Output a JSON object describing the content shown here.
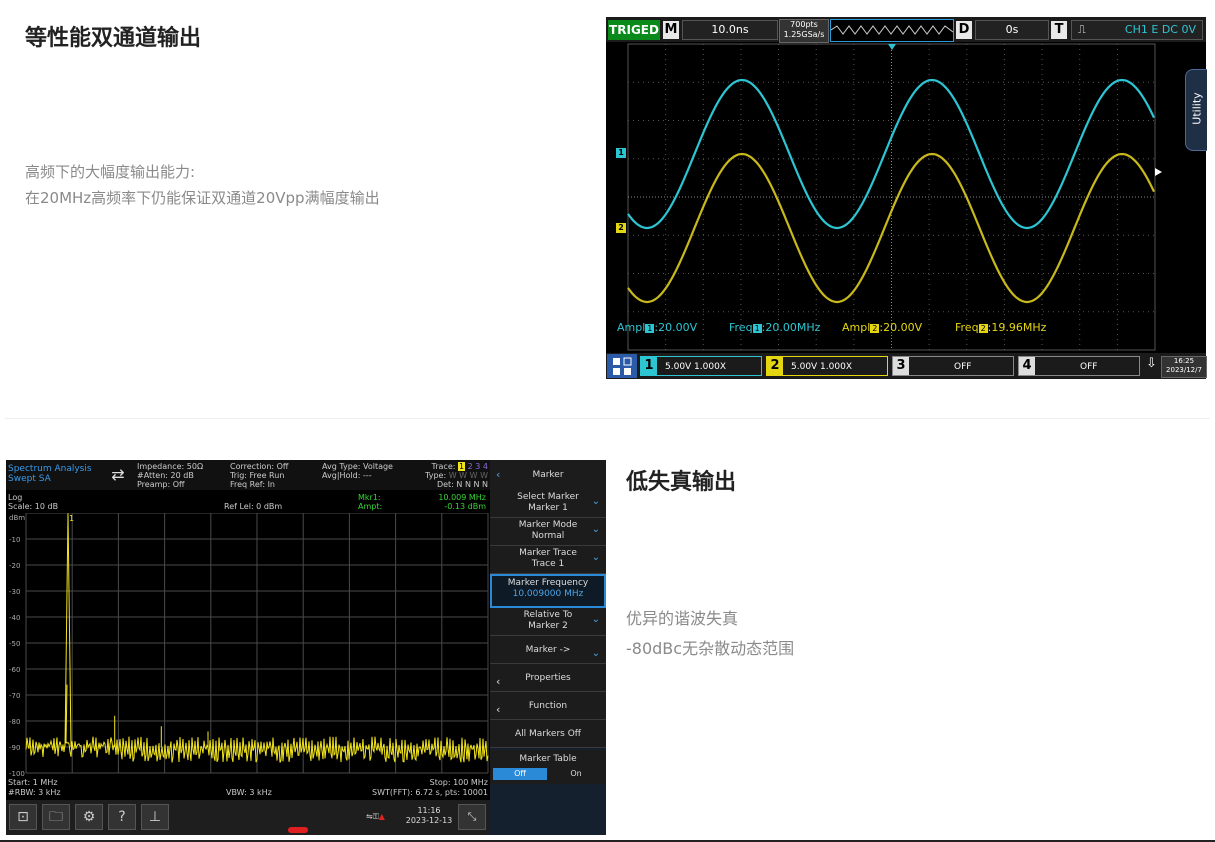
{
  "section1": {
    "title": "等性能双通道输出",
    "desc_line1": "高频下的大幅度输出能力:",
    "desc_line2": "在20MHz高频率下仍能保证双通道20Vpp满幅度输出"
  },
  "section2": {
    "title": "低失真输出",
    "desc_line1": "优异的谐波失真",
    "desc_line2": "-80dBc无杂散动态范围"
  },
  "scope": {
    "status": "TRIGED",
    "m_label": "M",
    "timebase": "10.0ns",
    "pts": "700pts",
    "sample_rate": "1.25GSa/s",
    "d_label": "D",
    "delay": "0s",
    "t_label": "T",
    "trigger_info": "CH1 E DC 0V",
    "utility": "Utility",
    "ch1_marker": "1",
    "ch2_marker": "2",
    "meas": {
      "ampl1_prefix": "Ampl",
      "ampl1_ch": "1",
      "ampl1_val": ":20.00V",
      "freq1_prefix": "Freq",
      "freq1_ch": "1",
      "freq1_val": ":20.00MHz",
      "ampl2_prefix": "Ampl",
      "ampl2_ch": "2",
      "ampl2_val": ":20.00V",
      "freq2_prefix": "Freq",
      "freq2_ch": "2",
      "freq2_val": ":19.96MHz"
    },
    "channels": [
      {
        "num": "1",
        "text": "5.00V 1.000X",
        "color": "#2ec5d3"
      },
      {
        "num": "2",
        "text": "5.00V 1.000X",
        "color": "#e5d612"
      },
      {
        "num": "3",
        "text": "OFF",
        "color": "#dddddd"
      },
      {
        "num": "4",
        "text": "OFF",
        "color": "#dddddd"
      }
    ],
    "time": "16:25",
    "date": "2023/12/7",
    "colors": {
      "ch1": "#2ec5d3",
      "ch2": "#c9b81c",
      "grid": "#555555"
    }
  },
  "spectrum": {
    "mode_line1": "Spectrum Analysis",
    "mode_line2": "Swept SA",
    "impedance": "Impedance: 50Ω",
    "atten": "#Atten: 20 dB",
    "preamp": "Preamp: Off",
    "correction": "Correction: Off",
    "trig": "Trig: Free Run",
    "freq_ref": "Freq Ref: In",
    "avg_type": "Avg Type: Voltage",
    "avg_hold": "Avg|Hold: ---",
    "trace_label": "Trace:",
    "type_label": "Type:",
    "det_label": "Det:",
    "trace_nums": [
      "1",
      "2",
      "3",
      "4"
    ],
    "type_vals": "W W W W",
    "det_vals": "N N N N",
    "log": "Log",
    "scale": "Scale: 10 dB",
    "ref_lvl": "Ref Lel: 0 dBm",
    "mkr_label": "Mkr1:",
    "mkr_freq": "10.009 MHz",
    "ampt_label": "Ampt:",
    "ampt_val": "-0.13 dBm",
    "unit": "dBm",
    "marker_num": "1",
    "yticks": [
      "-10",
      "-20",
      "-30",
      "-40",
      "-50",
      "-60",
      "-70",
      "-80",
      "-90",
      "-100"
    ],
    "start": "Start: 1 MHz",
    "stop": "Stop: 100 MHz",
    "rbw": "#RBW: 3 kHz",
    "vbw": "VBW: 3 kHz",
    "swt": "SWT(FFT): 6.72 s, pts: 10001",
    "time": "11:16",
    "date": "2023-12-13",
    "menu": {
      "header": "Marker",
      "items": [
        {
          "l1": "Select Marker",
          "l2": "Marker 1",
          "type": "down"
        },
        {
          "l1": "Marker Mode",
          "l2": "Normal",
          "type": "down"
        },
        {
          "l1": "Marker Trace",
          "l2": "Trace 1",
          "type": "down"
        },
        {
          "l1": "Marker Frequency",
          "l2": "10.009000 MHz",
          "type": "active"
        },
        {
          "l1": "Relative To",
          "l2": "Marker 2",
          "type": "down"
        },
        {
          "l1": "Marker ->",
          "l2": "",
          "type": "down"
        },
        {
          "l1": "Properties",
          "l2": "",
          "type": "left"
        },
        {
          "l1": "Function",
          "l2": "",
          "type": "left"
        },
        {
          "l1": "All Markers Off",
          "l2": "",
          "type": "none"
        }
      ],
      "table_label": "Marker Table",
      "off": "Off",
      "on": "On"
    },
    "colors": {
      "trace": "#f3e61c",
      "grid": "#4a4a4a",
      "accent": "#2a8ad8"
    }
  }
}
